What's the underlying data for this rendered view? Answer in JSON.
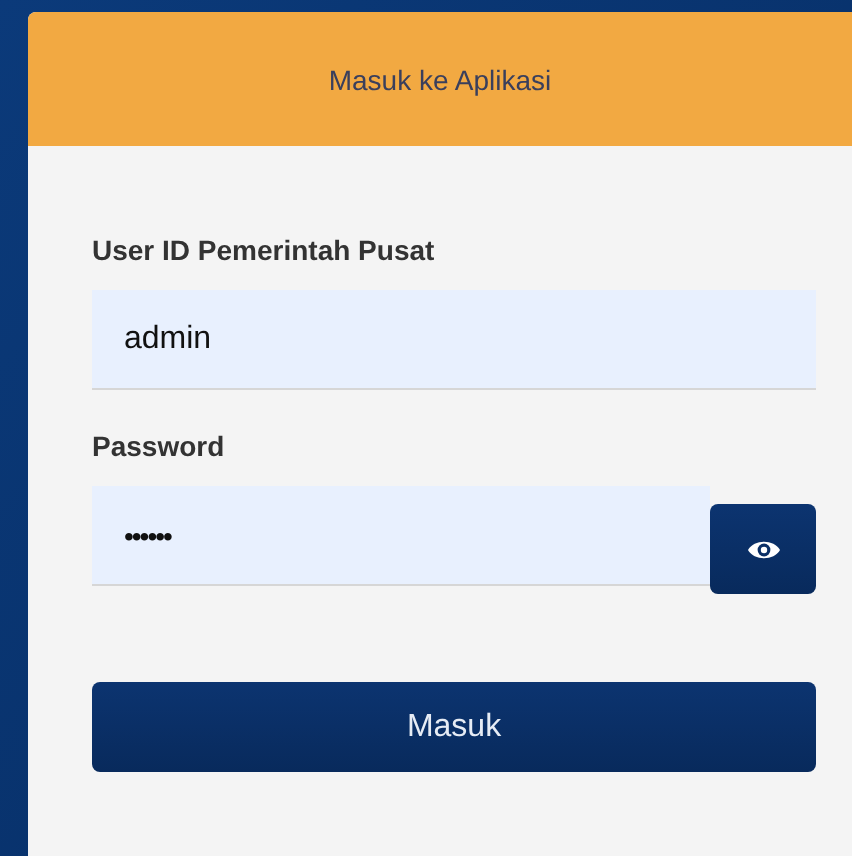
{
  "header": {
    "title": "Masuk ke Aplikasi"
  },
  "fields": [
    {
      "label": "User ID Pemerintah Pusat",
      "value": "admin",
      "kind": "text"
    },
    {
      "label": "Password",
      "value": "••••••",
      "kind": "password"
    }
  ],
  "submit": {
    "label": "Masuk"
  }
}
